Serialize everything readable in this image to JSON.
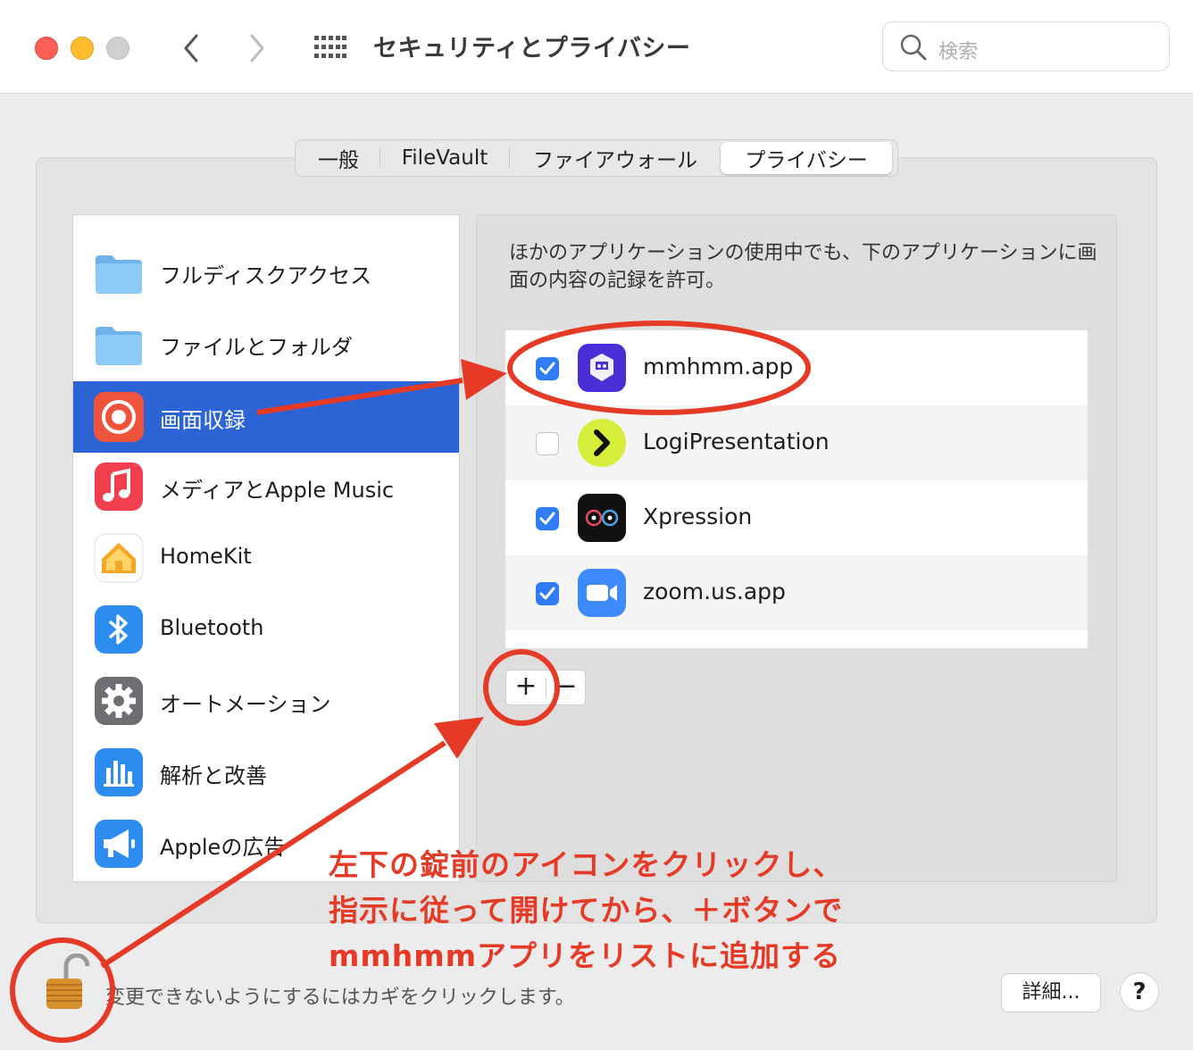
{
  "window": {
    "title": "セキュリティとプライバシー",
    "search_placeholder": "検索"
  },
  "tabs": [
    {
      "label": "一般",
      "active": false
    },
    {
      "label": "FileVault",
      "active": false
    },
    {
      "label": "ファイアウォール",
      "active": false
    },
    {
      "label": "プライバシー",
      "active": true
    }
  ],
  "sidebar": {
    "items": [
      {
        "label": "フルディスクアクセス",
        "icon": "folder-icon"
      },
      {
        "label": "ファイルとフォルダ",
        "icon": "folder-icon"
      },
      {
        "label": "画面収録",
        "icon": "screen-recording-icon",
        "selected": true
      },
      {
        "label": "メディアとApple Music",
        "icon": "music-icon"
      },
      {
        "label": "HomeKit",
        "icon": "home-icon"
      },
      {
        "label": "Bluetooth",
        "icon": "bluetooth-icon"
      },
      {
        "label": "オートメーション",
        "icon": "gear-icon"
      },
      {
        "label": "解析と改善",
        "icon": "analytics-icon"
      },
      {
        "label": "Appleの広告",
        "icon": "megaphone-icon"
      }
    ]
  },
  "main": {
    "description": "ほかのアプリケーションの使用中でも、下のアプリケーションに画面の内容の記録を許可。",
    "apps": [
      {
        "name": "mmhmm.app",
        "checked": true,
        "icon": "mmhmm-icon"
      },
      {
        "name": "LogiPresentation",
        "checked": false,
        "icon": "logi-presentation-icon"
      },
      {
        "name": "Xpression",
        "checked": true,
        "icon": "xpression-icon"
      },
      {
        "name": "zoom.us.app",
        "checked": true,
        "icon": "zoom-icon"
      }
    ],
    "add_label": "+",
    "remove_label": "−"
  },
  "footer": {
    "lock_text": "変更できないようにするにはカギをクリックします。",
    "details_label": "詳細...",
    "help_label": "?"
  },
  "annotation": {
    "lines": [
      "左下の錠前のアイコンをクリックし、",
      "指示に従って開けてから、＋ボタンで",
      "mmhmmアプリをリストに追加する"
    ],
    "color": "#e53a25"
  },
  "colors": {
    "selection": "#2c64d6",
    "checkbox": "#2f7cf6"
  }
}
